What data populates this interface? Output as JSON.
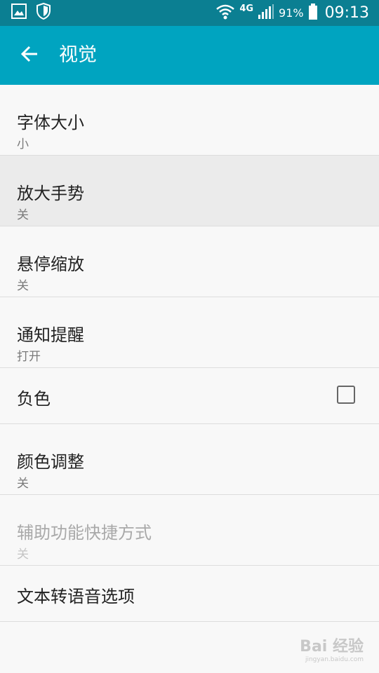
{
  "status_bar": {
    "network": "4G",
    "battery": "91%",
    "time": "09:13"
  },
  "header": {
    "title": "视觉"
  },
  "settings": [
    {
      "label": "字体大小",
      "value": "小"
    },
    {
      "label": "放大手势",
      "value": "关"
    },
    {
      "label": "悬停缩放",
      "value": "关"
    },
    {
      "label": "通知提醒",
      "value": "打开"
    },
    {
      "label": "负色",
      "checked": false
    },
    {
      "label": "颜色调整",
      "value": "关"
    },
    {
      "label": "辅助功能快捷方式",
      "value": "关"
    },
    {
      "label": "文本转语音选项"
    }
  ],
  "watermark": {
    "text": "Bai 经验",
    "sub": "jingyan.baidu.com"
  },
  "colors": {
    "status_bar": "#0b7f92",
    "app_bar": "#00a4c0",
    "background": "#f8f8f8",
    "selected_row": "#ebebeb"
  }
}
